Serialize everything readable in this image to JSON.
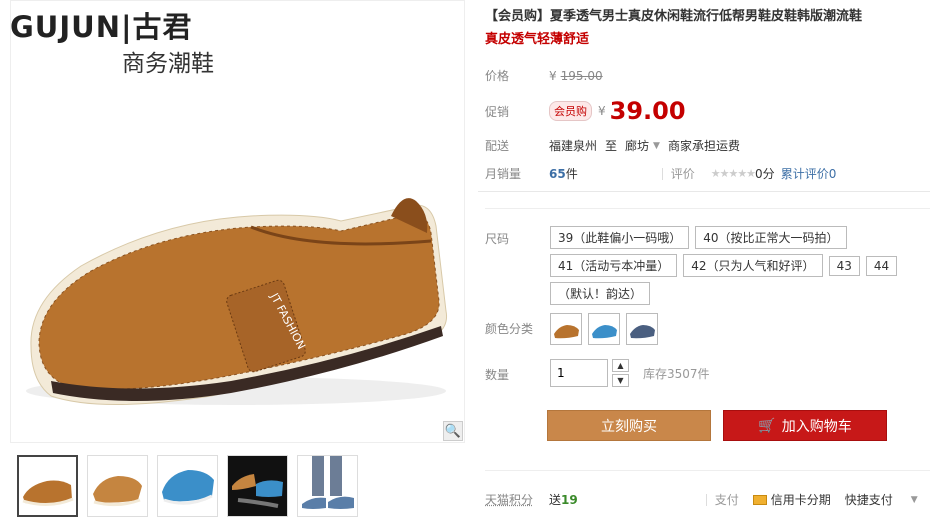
{
  "brand": {
    "name": "GUJUN|古君",
    "sub": "商务潮鞋"
  },
  "product": {
    "title": "【会员购】夏季透气男士真皮休闲鞋流行低帮男鞋皮鞋韩版潮流鞋",
    "subtitle": "真皮透气轻薄舒适"
  },
  "pricing": {
    "orig_label": "价格",
    "yen": "¥",
    "orig_price": "195.00",
    "promo_label": "促销",
    "promo_tag": "会员购",
    "price": "39.00"
  },
  "shipping": {
    "label": "配送",
    "from": "福建泉州",
    "to_word": "至",
    "dest": "廊坊",
    "fee": "商家承担运费"
  },
  "sales": {
    "label": "月销量",
    "count": "65",
    "unit": "件",
    "rating_label": "评价",
    "score": "0分",
    "review_link": "累计评价0"
  },
  "size": {
    "label": "尺码",
    "options": [
      "39（此鞋偏小一码哦）",
      "40（按比正常大一码拍）",
      "41（活动亏本冲量）",
      "42（只为人气和好评）",
      "43",
      "44",
      "（默认！韵达）"
    ]
  },
  "color": {
    "label": "颜色分类"
  },
  "quantity": {
    "label": "数量",
    "value": "1",
    "stock": "库存3507件"
  },
  "buttons": {
    "buy": "立刻购买",
    "cart": "加入购物车"
  },
  "footer": {
    "points_label": "天猫积分",
    "points_prefix": "送",
    "points": "19",
    "pay_label": "支付",
    "card": "信用卡分期",
    "quick": "快捷支付"
  },
  "colors": {
    "accent": "#c40000",
    "buy": "#c9874a",
    "cart": "#c71818",
    "link": "#3d6fa6"
  },
  "icons": {
    "zoom": "magnifier-icon",
    "cart": "cart-icon",
    "dropdown": "chevron-down-icon",
    "card": "credit-card-icon"
  }
}
